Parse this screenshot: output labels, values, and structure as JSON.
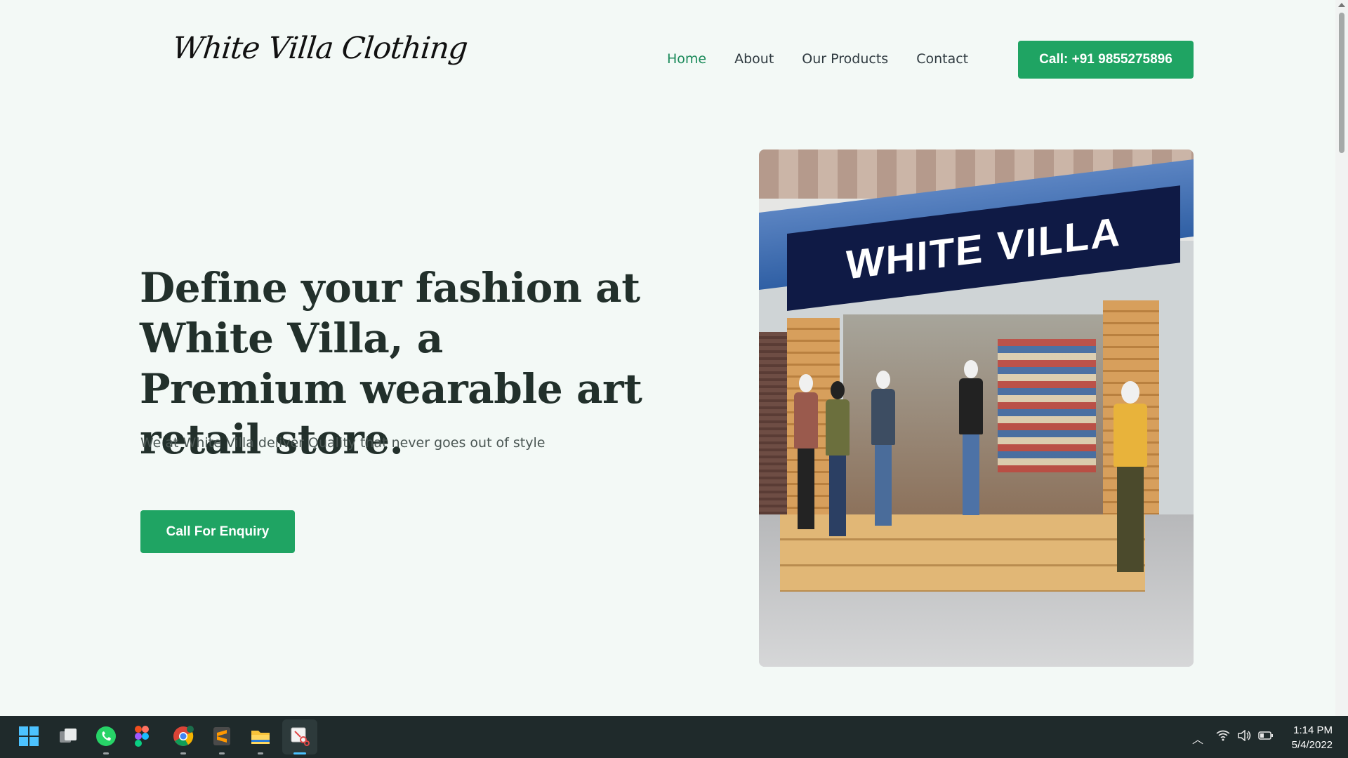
{
  "header": {
    "logo_text": "White Villa Clothing",
    "nav": [
      {
        "label": "Home",
        "active": true
      },
      {
        "label": "About",
        "active": false
      },
      {
        "label": "Our Products",
        "active": false
      },
      {
        "label": "Contact",
        "active": false
      }
    ],
    "call_button": "Call: +91 9855275896"
  },
  "hero": {
    "title": "Define your fashion at White Villa, a Premium wearable art retail store.",
    "subtitle": "We at White Villa deliver Quality that never goes out of style",
    "cta": "Call For Enquiry",
    "image_sign_text": "WHITE VILLA"
  },
  "colors": {
    "accent": "#1fa463",
    "nav_active": "#1b8a5a",
    "background": "#f3f9f6",
    "taskbar": "#1f2a2b"
  },
  "taskbar": {
    "apps": [
      "windows-start-icon",
      "task-view-icon",
      "whatsapp-icon",
      "figma-icon",
      "chrome-icon",
      "sublime-text-icon",
      "file-explorer-icon",
      "snipping-tool-icon"
    ],
    "tray": [
      "chevron-up-icon",
      "wifi-icon",
      "volume-icon",
      "battery-icon"
    ],
    "time": "1:14 PM",
    "date": "5/4/2022"
  }
}
